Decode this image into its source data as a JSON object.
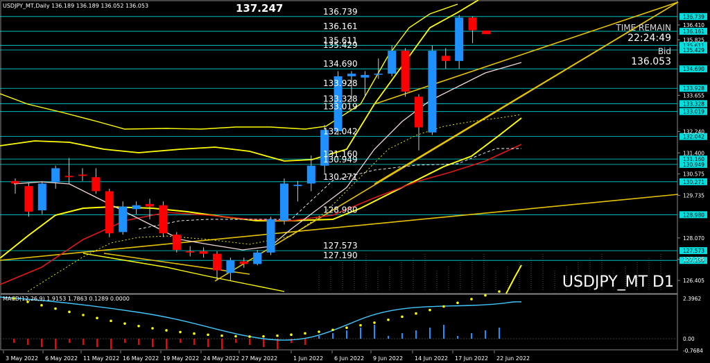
{
  "header": {
    "symbol_info": "USDJPY_MT,Daily  136.189 136.189 136.052 136.053",
    "big_price": "137.247"
  },
  "watermark": "USDJPY_MT D1",
  "info_panel": {
    "time_remain_label": "TIME REMAIN",
    "time_remain_value": "22:24:49",
    "bid_label": "Bid",
    "bid_value": "136.053"
  },
  "macd": {
    "label": "MACD(12,26,9) 1.9153 1.7863 0.1289 0.0000",
    "axis_ticks": [
      "2.3962",
      "0.00",
      "-0.7684"
    ]
  },
  "colors": {
    "background": "#000000",
    "bull_candle": "#1e90ff",
    "bear_candle": "#ff0000",
    "hline": "#00e0e0",
    "label_box": "#00e0e0",
    "bollinger": "#ffff00",
    "trendline": "#e6c300",
    "macd_signal": "#40c8ff",
    "macd_dots": "#ffff00"
  },
  "chart_data": {
    "type": "candlestick",
    "x_tick_labels": [
      "3 May 2022",
      "6 May 2022",
      "11 May 2022",
      "16 May 2022",
      "19 May 2022",
      "24 May 2022",
      "27 May 2022",
      "1 Jun 2022",
      "6 Jun 2022",
      "9 Jun 2022",
      "14 Jun 2022",
      "17 Jun 2022",
      "22 Jun 2022"
    ],
    "y_tick_labels": [
      "136.410",
      "135.825",
      "133.655",
      "132.240",
      "131.400",
      "130.575",
      "129.735",
      "128.070",
      "127.235",
      "126.405"
    ],
    "ylim": [
      126.0,
      137.35
    ],
    "horizontal_levels": [
      {
        "value": 136.739,
        "label": "136.739"
      },
      {
        "value": 136.161,
        "label": "136.161"
      },
      {
        "value": 135.611,
        "label": "135.611"
      },
      {
        "value": 135.429,
        "label": "135.429"
      },
      {
        "value": 134.69,
        "label": "134.690"
      },
      {
        "value": 133.928,
        "label": "133.928"
      },
      {
        "value": 133.328,
        "label": "133.328"
      },
      {
        "value": 133.019,
        "label": "133.019"
      },
      {
        "value": 132.042,
        "label": "132.042"
      },
      {
        "value": 131.16,
        "label": "131.160"
      },
      {
        "value": 130.949,
        "label": "130.949"
      },
      {
        "value": 130.271,
        "label": "130.271"
      },
      {
        "value": 128.98,
        "label": "128.980"
      },
      {
        "value": 127.573,
        "label": "127.573"
      },
      {
        "value": 127.19,
        "label": "127.190"
      }
    ],
    "candles": [
      {
        "o": 130.3,
        "h": 130.4,
        "l": 129.8,
        "c": 130.2
      },
      {
        "o": 130.1,
        "h": 130.25,
        "l": 128.9,
        "c": 129.1
      },
      {
        "o": 129.15,
        "h": 130.3,
        "l": 129.0,
        "c": 130.2
      },
      {
        "o": 130.25,
        "h": 130.9,
        "l": 130.0,
        "c": 130.8
      },
      {
        "o": 130.5,
        "h": 131.2,
        "l": 130.2,
        "c": 130.45
      },
      {
        "o": 130.55,
        "h": 130.8,
        "l": 130.3,
        "c": 130.5
      },
      {
        "o": 130.45,
        "h": 130.8,
        "l": 129.8,
        "c": 129.9
      },
      {
        "o": 129.9,
        "h": 130.0,
        "l": 128.1,
        "c": 128.25
      },
      {
        "o": 128.3,
        "h": 129.5,
        "l": 128.2,
        "c": 129.3
      },
      {
        "o": 129.2,
        "h": 129.5,
        "l": 129.0,
        "c": 129.35
      },
      {
        "o": 129.4,
        "h": 129.6,
        "l": 128.8,
        "c": 129.3
      },
      {
        "o": 129.35,
        "h": 129.5,
        "l": 128.1,
        "c": 128.25
      },
      {
        "o": 128.2,
        "h": 128.3,
        "l": 127.5,
        "c": 127.6
      },
      {
        "o": 127.55,
        "h": 127.75,
        "l": 127.35,
        "c": 127.5
      },
      {
        "o": 127.55,
        "h": 127.7,
        "l": 127.3,
        "c": 127.45
      },
      {
        "o": 127.45,
        "h": 127.55,
        "l": 126.4,
        "c": 126.8
      },
      {
        "o": 126.7,
        "h": 127.3,
        "l": 126.4,
        "c": 127.2
      },
      {
        "o": 127.15,
        "h": 127.3,
        "l": 126.9,
        "c": 127.05
      },
      {
        "o": 127.05,
        "h": 127.6,
        "l": 127.0,
        "c": 127.5
      },
      {
        "o": 127.5,
        "h": 128.9,
        "l": 127.4,
        "c": 128.8
      },
      {
        "o": 128.75,
        "h": 130.4,
        "l": 128.6,
        "c": 130.2
      },
      {
        "o": 130.1,
        "h": 130.3,
        "l": 129.5,
        "c": 130.15
      },
      {
        "o": 130.2,
        "h": 131.3,
        "l": 129.9,
        "c": 130.9
      },
      {
        "o": 130.9,
        "h": 132.5,
        "l": 130.6,
        "c": 132.3
      },
      {
        "o": 132.25,
        "h": 134.6,
        "l": 132.1,
        "c": 134.4
      },
      {
        "o": 134.4,
        "h": 134.6,
        "l": 133.4,
        "c": 134.5
      },
      {
        "o": 134.35,
        "h": 134.6,
        "l": 133.6,
        "c": 134.45
      },
      {
        "o": 134.5,
        "h": 135.1,
        "l": 134.3,
        "c": 134.5
      },
      {
        "o": 134.5,
        "h": 135.6,
        "l": 134.4,
        "c": 135.4
      },
      {
        "o": 135.4,
        "h": 135.5,
        "l": 133.6,
        "c": 133.8
      },
      {
        "o": 133.6,
        "h": 133.7,
        "l": 131.5,
        "c": 132.4
      },
      {
        "o": 132.2,
        "h": 135.6,
        "l": 132.1,
        "c": 135.4
      },
      {
        "o": 135.2,
        "h": 135.5,
        "l": 134.7,
        "c": 135.0
      },
      {
        "o": 135.0,
        "h": 136.8,
        "l": 134.7,
        "c": 136.7
      },
      {
        "o": 136.7,
        "h": 136.75,
        "l": 135.7,
        "c": 136.2
      },
      {
        "o": 136.19,
        "h": 136.19,
        "l": 136.05,
        "c": 136.05
      }
    ]
  }
}
